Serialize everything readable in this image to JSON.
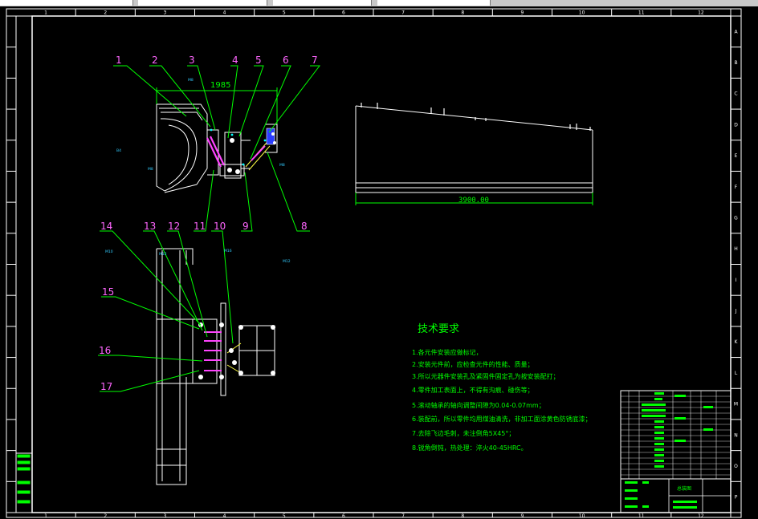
{
  "colors": {
    "background": "#000000",
    "frame": "#ffffff",
    "leader": "#00ff00",
    "balloon_text": "#ff66ff",
    "dimension": "#00ff00",
    "tech_text": "#00ff00",
    "spring": "#ff44ff",
    "label_blue": "#33ccff",
    "cyan_mark": "#00ffff"
  },
  "grid": {
    "columns": [
      "1",
      "2",
      "3",
      "4",
      "5",
      "6",
      "7",
      "8",
      "9",
      "10",
      "11",
      "12"
    ],
    "rows": [
      "A",
      "B",
      "C",
      "D",
      "E",
      "F",
      "G",
      "H",
      "I",
      "J",
      "K",
      "L",
      "M",
      "N",
      "O",
      "P"
    ]
  },
  "balloons": [
    "1",
    "2",
    "3",
    "4",
    "5",
    "6",
    "7",
    "8",
    "9",
    "10",
    "11",
    "12",
    "13",
    "14",
    "15",
    "16",
    "17"
  ],
  "dimensions": {
    "top_view_width": "1985",
    "side_view_length": "3900.00"
  },
  "view_labels": [
    "M8",
    "B4",
    "M8",
    "M8",
    "M10",
    "M12",
    "M16",
    "M12"
  ],
  "technical_requirements": {
    "title": "技术要求",
    "items": [
      "1.各元件安装应做标记，",
      "2.安装元件前，应检查元件的性能、质量；",
      "3.所以元器件安装孔及紧固件固定孔为按安装配打；",
      "4.零件加工表面上，不得有沟痕、碰伤等；",
      "5.滚动轴承的轴向调整间隙为0.04-0.07mm；",
      "6.装配前，所以零件均用煤油清洗，非加工面涂黄色防锈底漆；",
      "7.去除飞边毛刺，未注倒角5X45°；",
      "8.锐角倒钝，热处理：淬火40-45HRC。"
    ]
  },
  "title_block": {
    "name": "总装图"
  }
}
